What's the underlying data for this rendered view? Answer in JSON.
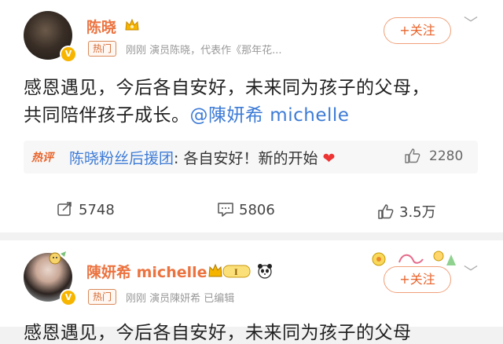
{
  "post1": {
    "author": "陈晓",
    "tag": "热门",
    "meta": "刚刚   演员陈晓，代表作《那年花...",
    "follow": "+关注",
    "body_line1": "感恩遇见，今后各自安好，未来同为孩子的父母，",
    "body_line2": "共同陪伴孩子成长。",
    "mention": "@陳妍希 michelle",
    "hot": {
      "label": "热评",
      "user": "陈晓粉丝后援团",
      "text": ": 各自安好！新的开始",
      "likes": "2280"
    },
    "actions": {
      "reposts": "5748",
      "comments": "5806",
      "likes": "3.5万"
    }
  },
  "post2": {
    "author": "陳妍希 michelle",
    "tag": "热门",
    "meta": "刚刚   演员陳妍希  已编辑",
    "follow": "+关注",
    "body_partial": "感恩遇见，今后各自安好，未来同为孩子的父母"
  },
  "icons": {
    "verified": "verified-badge-icon",
    "crown": "vip-crown-icon",
    "chevron": "chevron-down-icon",
    "repost": "repost-icon",
    "comment": "comment-icon",
    "like": "thumbs-up-icon",
    "heart": "heart-icon",
    "panda": "panda-icon"
  },
  "colors": {
    "accent": "#eb7340",
    "link": "#3d7bd6",
    "badge": "#f7b500"
  }
}
